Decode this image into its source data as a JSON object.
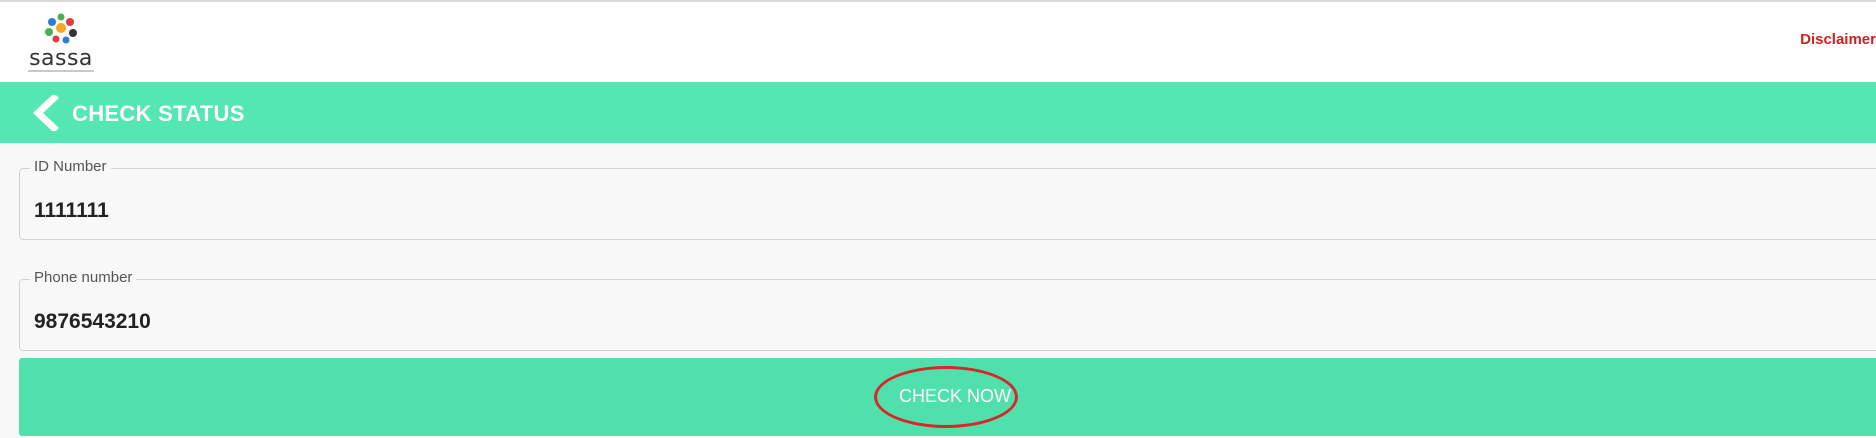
{
  "header": {
    "logo_text": "sassa",
    "disclaimer_label": "Disclaimer"
  },
  "titlebar": {
    "title": "CHECK STATUS",
    "back_icon": "chevron-left-icon"
  },
  "form": {
    "id_number": {
      "label": "ID Number",
      "value": "1111111"
    },
    "phone_number": {
      "label": "Phone number",
      "value": "9876543210"
    }
  },
  "actions": {
    "check_now_label": "CHECK NOW"
  },
  "colors": {
    "accent": "#54e7b3",
    "button": "#50e0ab",
    "disclaimer": "#d32020",
    "annotation": "#d8262a"
  }
}
